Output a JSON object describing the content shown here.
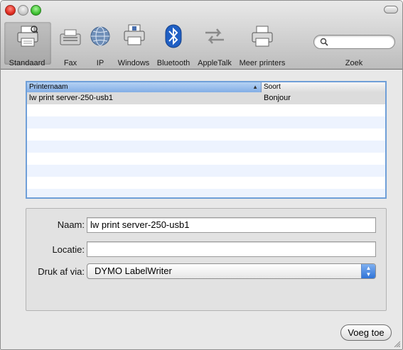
{
  "window": {
    "traffic_lights": [
      "close-button",
      "minimize-button",
      "zoom-button"
    ]
  },
  "toolbar": {
    "items": [
      {
        "label": "Standaard",
        "icon": "printer-icon",
        "selected": true
      },
      {
        "label": "Fax",
        "icon": "fax-icon"
      },
      {
        "label": "IP",
        "icon": "globe-icon"
      },
      {
        "label": "Windows",
        "icon": "windows-printer-icon"
      },
      {
        "label": "Bluetooth",
        "icon": "bluetooth-icon"
      },
      {
        "label": "AppleTalk",
        "icon": "appletalk-icon"
      },
      {
        "label": "Meer printers",
        "icon": "more-printers-icon"
      }
    ],
    "search_label": "Zoek",
    "search_value": ""
  },
  "printer_list": {
    "columns": [
      "Printernaam",
      "Soort"
    ],
    "rows": [
      {
        "name": "lw print server-250-usb1",
        "kind": "Bonjour"
      }
    ]
  },
  "form": {
    "name_label": "Naam:",
    "name_value": "lw print server-250-usb1",
    "location_label": "Locatie:",
    "location_value": "",
    "print_via_label": "Druk af via:",
    "print_via_value": "DYMO LabelWriter"
  },
  "add_button_label": "Voeg toe",
  "colors": {
    "accent": "#2f73d8",
    "selection_row": "#dcdcdc",
    "alt_row": "#edf3fe"
  }
}
